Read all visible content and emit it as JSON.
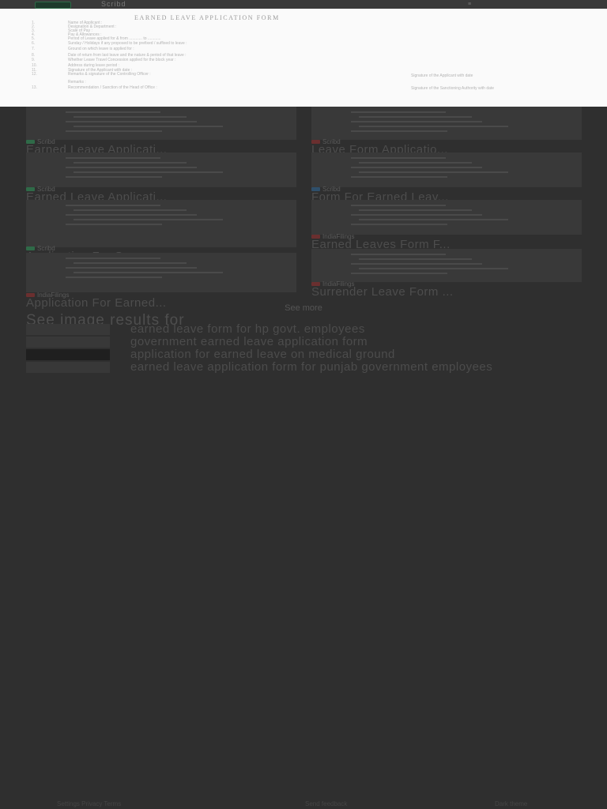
{
  "topbar": {
    "logo": "",
    "title": "Scribd",
    "menu": "≡"
  },
  "document": {
    "title": "EARNED LEAVE APPLICATION FORM",
    "items": [
      {
        "num": "1.",
        "text": "Name of Applicant :"
      },
      {
        "num": "2.",
        "text": "Designation & Department :"
      },
      {
        "num": "3.",
        "text": "Scale of Pay :"
      },
      {
        "num": "4.",
        "text": "Pay & Allowances :"
      },
      {
        "num": "5.",
        "text": "Period of Leave applied for & from ............ to ............"
      },
      {
        "num": "6.",
        "text": "Sunday / Holidays if any proposed to be prefixed / suffixed to leave :"
      },
      {
        "num": "7.",
        "text": "Ground on which leave is applied for :"
      },
      {
        "num": "8.",
        "text": "Date of return from last leave and the nature & period of that leave :"
      },
      {
        "num": "9.",
        "text": "Whether Leave Travel Concession applied for the block year :"
      },
      {
        "num": "10.",
        "text": "Address during leave period :"
      },
      {
        "num": "11.",
        "text": "Signature of the Applicant with date :"
      },
      {
        "num": "12.",
        "text": "Remarks & signature of the Controlling Officer :"
      },
      {
        "num": "",
        "text": "Remarks :"
      },
      {
        "num": "13.",
        "text": "Recommendation / Sanction of the Head of Office :"
      }
    ],
    "sign1": "Signature of the Applicant with date",
    "sign2": "Signature of the Sanctioning Authority with date"
  },
  "results": [
    {
      "source": "Scribd",
      "title": "Earned Leave Applicati...",
      "fav": "#2f6a48"
    },
    {
      "source": "Scribd",
      "title": "Leave Form Applicatio...",
      "fav": "#6a2f2f"
    },
    {
      "source": "Scribd",
      "title": "Earned Leave Applicati...",
      "fav": "#2f6a48"
    },
    {
      "source": "Scribd",
      "title": "Form For Earned Leav...",
      "fav": "#2f4f6a"
    },
    {
      "source": "Scribd",
      "title": "Application For Su...",
      "fav": "#2f6a48"
    },
    {
      "source": "IndiaFilings",
      "title": "Earned Leaves Form F...",
      "fav": "#6a2f2f"
    },
    {
      "source": "IndiaFilings",
      "title": "Application For Earned...",
      "fav": "#6a2f2f"
    },
    {
      "source": "IndiaFilings",
      "title": "Surrender Leave Form ...",
      "fav": "#6a2f2f"
    }
  ],
  "see_more": "See more",
  "see_image_results": "See image results for",
  "related": [
    "earned leave form for hp govt. employees",
    "government earned leave application form",
    "application for earned leave on medical ground",
    "earned leave application form for punjab government employees"
  ],
  "footer": {
    "left": "Settings  Privacy  Terms",
    "center": "Send feedback",
    "right": "Dark theme"
  }
}
